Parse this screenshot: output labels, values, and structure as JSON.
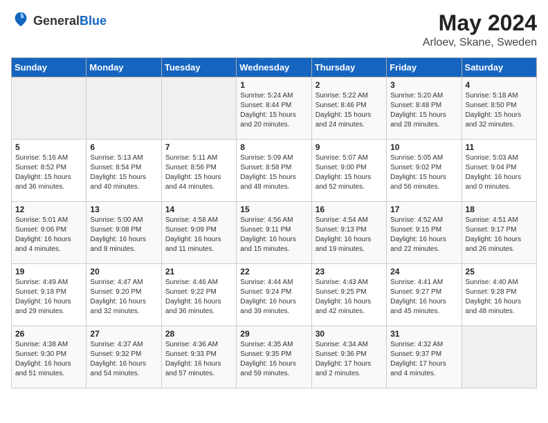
{
  "header": {
    "logo_general": "General",
    "logo_blue": "Blue",
    "month": "May 2024",
    "location": "Arloev, Skane, Sweden"
  },
  "weekdays": [
    "Sunday",
    "Monday",
    "Tuesday",
    "Wednesday",
    "Thursday",
    "Friday",
    "Saturday"
  ],
  "weeks": [
    [
      {
        "day": "",
        "info": ""
      },
      {
        "day": "",
        "info": ""
      },
      {
        "day": "",
        "info": ""
      },
      {
        "day": "1",
        "info": "Sunrise: 5:24 AM\nSunset: 8:44 PM\nDaylight: 15 hours\nand 20 minutes."
      },
      {
        "day": "2",
        "info": "Sunrise: 5:22 AM\nSunset: 8:46 PM\nDaylight: 15 hours\nand 24 minutes."
      },
      {
        "day": "3",
        "info": "Sunrise: 5:20 AM\nSunset: 8:48 PM\nDaylight: 15 hours\nand 28 minutes."
      },
      {
        "day": "4",
        "info": "Sunrise: 5:18 AM\nSunset: 8:50 PM\nDaylight: 15 hours\nand 32 minutes."
      }
    ],
    [
      {
        "day": "5",
        "info": "Sunrise: 5:16 AM\nSunset: 8:52 PM\nDaylight: 15 hours\nand 36 minutes."
      },
      {
        "day": "6",
        "info": "Sunrise: 5:13 AM\nSunset: 8:54 PM\nDaylight: 15 hours\nand 40 minutes."
      },
      {
        "day": "7",
        "info": "Sunrise: 5:11 AM\nSunset: 8:56 PM\nDaylight: 15 hours\nand 44 minutes."
      },
      {
        "day": "8",
        "info": "Sunrise: 5:09 AM\nSunset: 8:58 PM\nDaylight: 15 hours\nand 48 minutes."
      },
      {
        "day": "9",
        "info": "Sunrise: 5:07 AM\nSunset: 9:00 PM\nDaylight: 15 hours\nand 52 minutes."
      },
      {
        "day": "10",
        "info": "Sunrise: 5:05 AM\nSunset: 9:02 PM\nDaylight: 15 hours\nand 56 minutes."
      },
      {
        "day": "11",
        "info": "Sunrise: 5:03 AM\nSunset: 9:04 PM\nDaylight: 16 hours\nand 0 minutes."
      }
    ],
    [
      {
        "day": "12",
        "info": "Sunrise: 5:01 AM\nSunset: 9:06 PM\nDaylight: 16 hours\nand 4 minutes."
      },
      {
        "day": "13",
        "info": "Sunrise: 5:00 AM\nSunset: 9:08 PM\nDaylight: 16 hours\nand 8 minutes."
      },
      {
        "day": "14",
        "info": "Sunrise: 4:58 AM\nSunset: 9:09 PM\nDaylight: 16 hours\nand 11 minutes."
      },
      {
        "day": "15",
        "info": "Sunrise: 4:56 AM\nSunset: 9:11 PM\nDaylight: 16 hours\nand 15 minutes."
      },
      {
        "day": "16",
        "info": "Sunrise: 4:54 AM\nSunset: 9:13 PM\nDaylight: 16 hours\nand 19 minutes."
      },
      {
        "day": "17",
        "info": "Sunrise: 4:52 AM\nSunset: 9:15 PM\nDaylight: 16 hours\nand 22 minutes."
      },
      {
        "day": "18",
        "info": "Sunrise: 4:51 AM\nSunset: 9:17 PM\nDaylight: 16 hours\nand 26 minutes."
      }
    ],
    [
      {
        "day": "19",
        "info": "Sunrise: 4:49 AM\nSunset: 9:18 PM\nDaylight: 16 hours\nand 29 minutes."
      },
      {
        "day": "20",
        "info": "Sunrise: 4:47 AM\nSunset: 9:20 PM\nDaylight: 16 hours\nand 32 minutes."
      },
      {
        "day": "21",
        "info": "Sunrise: 4:46 AM\nSunset: 9:22 PM\nDaylight: 16 hours\nand 36 minutes."
      },
      {
        "day": "22",
        "info": "Sunrise: 4:44 AM\nSunset: 9:24 PM\nDaylight: 16 hours\nand 39 minutes."
      },
      {
        "day": "23",
        "info": "Sunrise: 4:43 AM\nSunset: 9:25 PM\nDaylight: 16 hours\nand 42 minutes."
      },
      {
        "day": "24",
        "info": "Sunrise: 4:41 AM\nSunset: 9:27 PM\nDaylight: 16 hours\nand 45 minutes."
      },
      {
        "day": "25",
        "info": "Sunrise: 4:40 AM\nSunset: 9:28 PM\nDaylight: 16 hours\nand 48 minutes."
      }
    ],
    [
      {
        "day": "26",
        "info": "Sunrise: 4:38 AM\nSunset: 9:30 PM\nDaylight: 16 hours\nand 51 minutes."
      },
      {
        "day": "27",
        "info": "Sunrise: 4:37 AM\nSunset: 9:32 PM\nDaylight: 16 hours\nand 54 minutes."
      },
      {
        "day": "28",
        "info": "Sunrise: 4:36 AM\nSunset: 9:33 PM\nDaylight: 16 hours\nand 57 minutes."
      },
      {
        "day": "29",
        "info": "Sunrise: 4:35 AM\nSunset: 9:35 PM\nDaylight: 16 hours\nand 59 minutes."
      },
      {
        "day": "30",
        "info": "Sunrise: 4:34 AM\nSunset: 9:36 PM\nDaylight: 17 hours\nand 2 minutes."
      },
      {
        "day": "31",
        "info": "Sunrise: 4:32 AM\nSunset: 9:37 PM\nDaylight: 17 hours\nand 4 minutes."
      },
      {
        "day": "",
        "info": ""
      }
    ]
  ]
}
